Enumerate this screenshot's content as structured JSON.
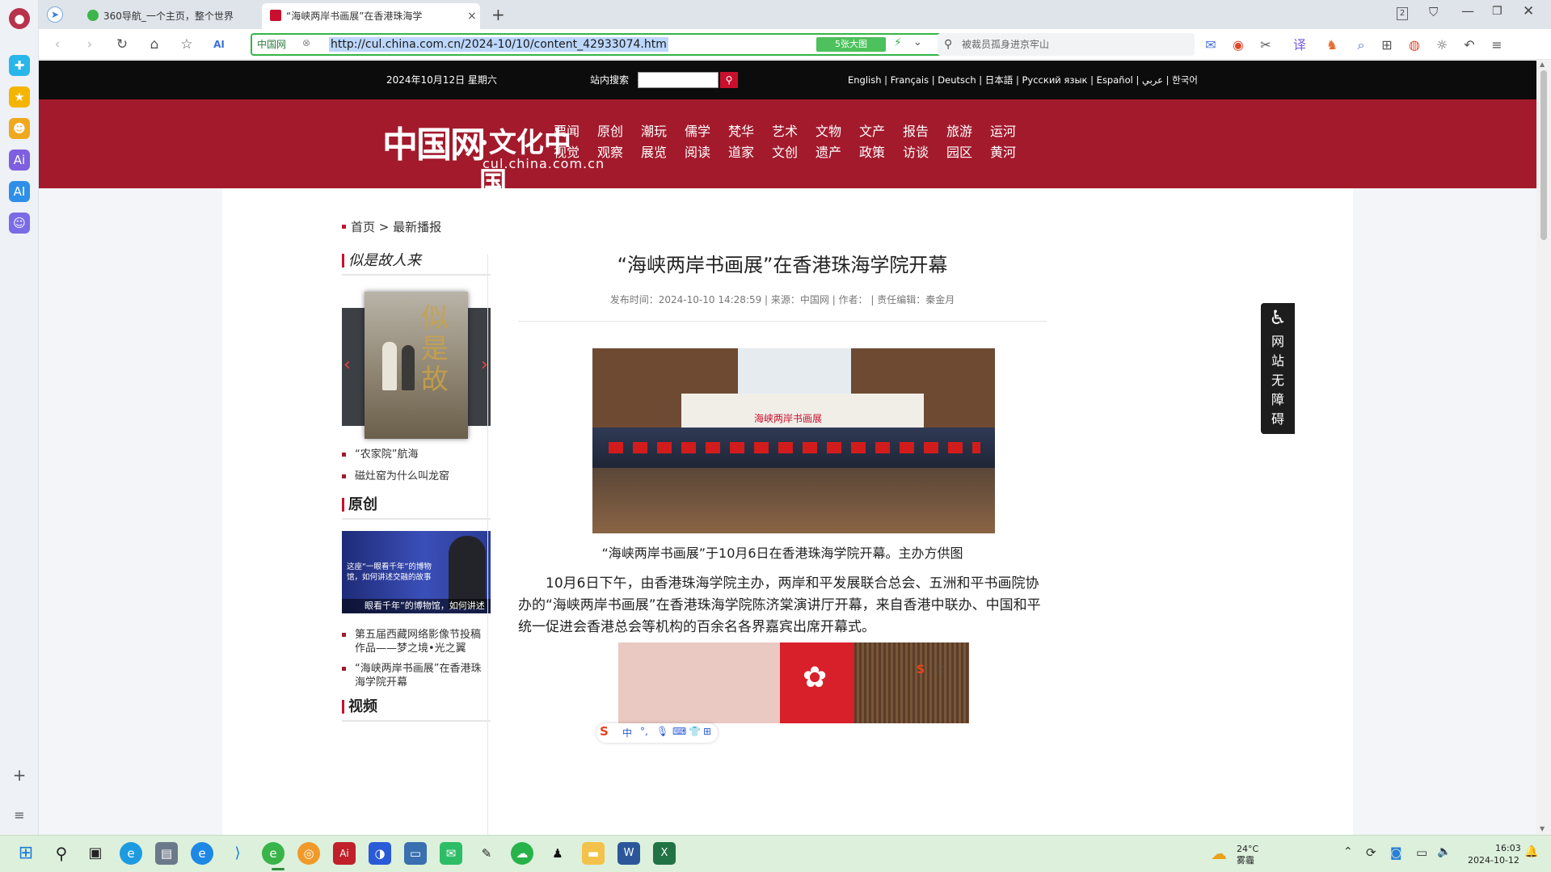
{
  "browser": {
    "tabs": [
      {
        "label": "360导航_一个主页，整个世界",
        "active": false
      },
      {
        "label": "“海峡两岸书画展”在香港珠海学",
        "active": true
      }
    ],
    "new_tab_symbol": "+",
    "close_symbol": "×",
    "window_badge": "2",
    "url_badge": "中国网",
    "url": "http://cul.china.com.cn/2024-10/10/content_42933074.htm",
    "big_button": "5张大图",
    "search_placeholder": "被裁员孤身进京牢山"
  },
  "site": {
    "date": "2024年10月12日 星期六",
    "search_label": "站内搜索",
    "languages": "English | Français | Deutsch | 日本語 | Русский язык | Español | عربي | 한국어",
    "logo_main": "中国网",
    "logo_sub": "·文化中国",
    "logo_domain": "cul.china.com.cn",
    "nav_top": [
      "要闻",
      "原创",
      "潮玩",
      "儒学",
      "梵华",
      "艺术",
      "文物",
      "文产",
      "报告",
      "旅游",
      "运河"
    ],
    "nav_bottom": [
      "视觉",
      "观察",
      "展览",
      "阅读",
      "道家",
      "文创",
      "遗产",
      "政策",
      "访谈",
      "园区",
      "黄河"
    ]
  },
  "breadcrumb": {
    "home": "首页",
    "sep": ">",
    "current": "最新播报"
  },
  "left_column": {
    "section1_title": "似是故人来",
    "carousel_prev": "‹",
    "carousel_next": "›",
    "section1_items": [
      "“农家院”航海",
      "磁灶窑为什么叫龙窑"
    ],
    "section2_title": "原创",
    "banner_caption": "这座“一眼看千年”的博物馆，如何讲述交融的故事",
    "banner_footer": "眼看千年”的博物馆，如何讲述",
    "section2_items": [
      "第五届西藏网络影像节投稿作品——梦之境•光之翼",
      "“海峡两岸书画展”在香港珠海学院开幕"
    ],
    "section3_title": "视频"
  },
  "article": {
    "title": "“海峡两岸书画展”在香港珠海学院开幕",
    "meta": "发布时间：2024-10-10 14:28:59 | 来源：中国网 | 作者： | 责任编辑：秦金月",
    "photo_banner": "海峡两岸书画展",
    "caption": "“海峡两岸书画展”于10月6日在香港珠海学院开幕。主办方供图",
    "paragraph": "10月6日下午，由香港珠海学院主办，两岸和平发展联合总会、五洲和平书画院协办的“海峡两岸书画展”在香港珠海学院陈济棠演讲厅开幕，来自香港中联办、中国和平统一促进会香港总会等机构的百余名各界嘉宾出席开幕式。"
  },
  "accessibility": {
    "chars": [
      "网",
      "站",
      "无",
      "障",
      "碍"
    ]
  },
  "taskbar": {
    "weather_temp": "24°C",
    "weather_desc": "雾霾",
    "time": "16:03",
    "date": "2024-10-12"
  },
  "colors": {
    "brand_red": "#a31a2c",
    "accent_red": "#c8102e",
    "taskbar": "#dcf0dc"
  }
}
